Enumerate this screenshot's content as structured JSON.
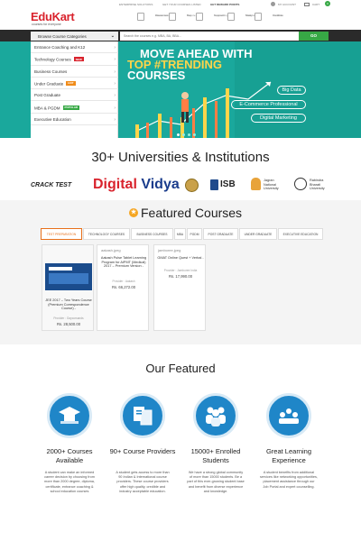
{
  "topbar": {
    "enterprise": "ENTERPRISE SOLUTIONS",
    "find_courses": "GET YOUR COURSES LISTED",
    "reward": "GET REWARD POINTS",
    "account": "MY ACCOUNT",
    "cart": "CART",
    "cart_count": "0"
  },
  "header": {
    "logo": "EduKart",
    "tagline": "courses for everyone",
    "features": [
      {
        "line1": "Guaranteed",
        "line2": "Placement"
      },
      {
        "line1": "Secure",
        "line2": "Pay"
      },
      {
        "line1": "Counselling",
        "line2": "Support"
      },
      {
        "line1": "Study",
        "line2": "Material"
      },
      {
        "line1": "Credible",
        "line2": "Institutes"
      }
    ]
  },
  "nav": {
    "browse_label": "Browse Course Categories",
    "search_placeholder": "Search the courses e.g. MBA, BA, BBA...",
    "go_label": "GO"
  },
  "menu": [
    {
      "label": "Entrance Coaching and K12",
      "tag": ""
    },
    {
      "label": "Technology Courses",
      "tag": "NEW"
    },
    {
      "label": "Business Courses",
      "tag": ""
    },
    {
      "label": "Under Graduate",
      "tag": "HOT"
    },
    {
      "label": "Post Graduate",
      "tag": ""
    },
    {
      "label": "MBA & PGDM",
      "tag": "POPULAR"
    },
    {
      "label": "Executive Education",
      "tag": ""
    }
  ],
  "hero": {
    "line1": "MOVE AHEAD WITH",
    "line2": "TOP #TRENDING",
    "line3": "COURSES",
    "pills": [
      "Big Data",
      "E-Commerce Professional",
      "Digital Marketing"
    ]
  },
  "universities": {
    "title": "30+ Universities & Institutions",
    "logos": {
      "cracktest": "CRACK TEST",
      "dv1": "Digital",
      "dv2": "Vidya",
      "isb": "ISB",
      "jagran1": "Jagran",
      "jagran2": "National",
      "jagran3": "University",
      "rabi1": "Rabindra",
      "rabi2": "Bharati",
      "rabi3": "University"
    }
  },
  "featured_courses": {
    "title": "Featured Courses",
    "tabs": [
      "TEST PREPARATION",
      "TECHNOLOGY COURSES",
      "BUSINESS COURSES",
      "MBA",
      "PGDM",
      "POST GRADUATE",
      "UNDER GRADUATE",
      "EXECUTIVE EDUCATION"
    ],
    "cards": [
      {
        "file": "",
        "title": "JEE 2017 – Two Years Course (Premium Correspondence Course) -",
        "provider": "Provider : Gaycorsands",
        "price": "Rs. 28,500.00"
      },
      {
        "file": "aakash.jpeg",
        "title": "Aakash Pulse Tablet Learning Program for AIPMT (Medical) 2017 – Premium Version -",
        "provider": "Provider : Aakash",
        "price": "Rs. 66,272.00"
      },
      {
        "file": "jamboree.jpeg",
        "title": "GMAT Online Quest + Verbal -",
        "provider": "Provider : Jamboree India",
        "price": "Rs. 17,990.00"
      }
    ]
  },
  "our_featured": {
    "title": "Our Featured",
    "items": [
      {
        "title": "2000+ Courses Available",
        "desc": "A student can make an informed career decision by choosing from more than 2000 degree, diploma, certificate, entrance coaching & school education courses"
      },
      {
        "title": "90+ Course Providers",
        "desc": "A student gets access to more than 90 Indian & International course providers. These course providers offer high quality, credible and industry acceptable education."
      },
      {
        "title": "15000+ Enrolled Students",
        "desc": "We have a strong global community of more than 15000 students. Be a part of this ever-growing student base and benefit from diverse experience and knowledge."
      },
      {
        "title": "Great Learning Experience",
        "desc": "A student benefits from additional services like networking opportunities, placement assistance through our Job Portal and expert counselling."
      }
    ]
  },
  "colors": {
    "brand_red": "#d9232d",
    "teal": "#1aa89c",
    "green": "#37a845",
    "blue": "#1f86c8",
    "orange": "#e8701a"
  }
}
